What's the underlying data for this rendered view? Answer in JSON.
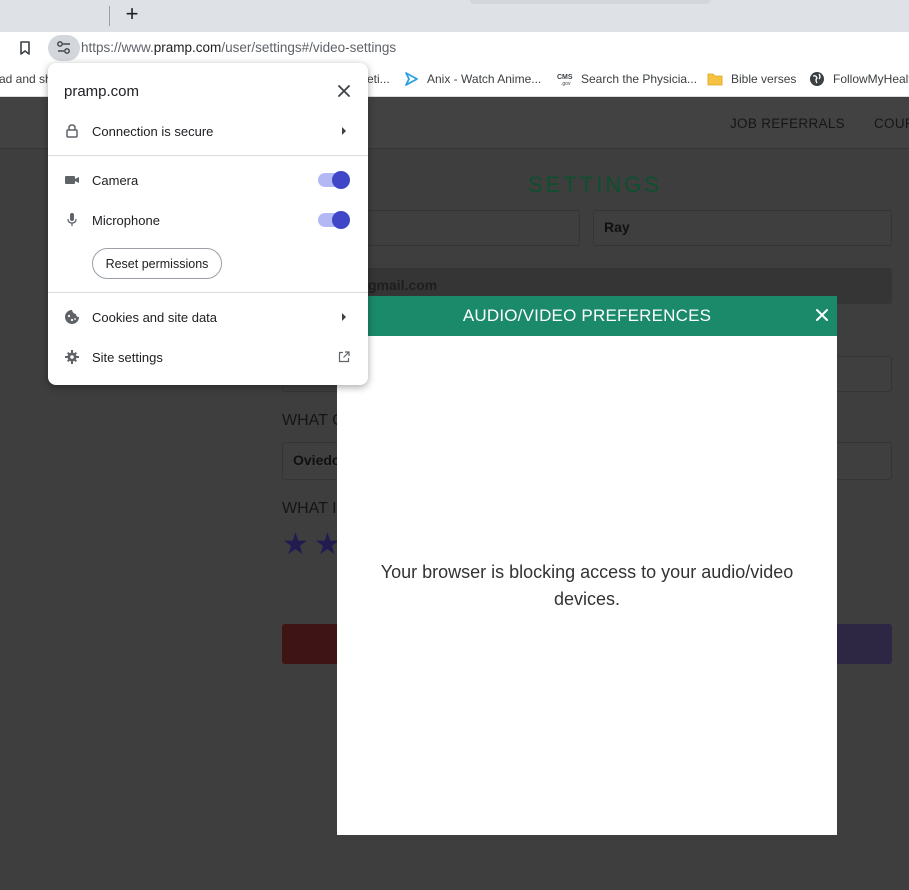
{
  "browser": {
    "new_tab_icon": "+",
    "url_prefix": "https://www.",
    "url_host": "pramp.com",
    "url_path": "/user/settings#/video-settings",
    "bookmarks": [
      {
        "label": "ad and sh",
        "icon": "none"
      },
      {
        "label": "eti...",
        "icon": "none"
      },
      {
        "label": "Anix - Watch Anime...",
        "icon": "play-icon"
      },
      {
        "label": "Search the Physicia...",
        "icon": "cms-icon"
      },
      {
        "label": "Bible verses",
        "icon": "folder-icon"
      },
      {
        "label": "FollowMyHealth",
        "icon": "globe-icon"
      }
    ]
  },
  "page": {
    "nav": [
      {
        "label": "JOB REFERRALS"
      },
      {
        "label": "COURSES"
      }
    ],
    "title": "SETTINGS",
    "last_name_value": "Ray",
    "email_value": "gmail.com",
    "location_label": "WHAT C",
    "location_value": "Oviedo",
    "level_label": "WHAT IS"
  },
  "modal": {
    "title": "AUDIO/VIDEO PREFERENCES",
    "message": "Your browser is blocking access to your audio/video devices."
  },
  "site_info": {
    "domain": "pramp.com",
    "connection_label": "Connection is secure",
    "camera_label": "Camera",
    "camera_enabled": true,
    "microphone_label": "Microphone",
    "microphone_enabled": true,
    "reset_label": "Reset permissions",
    "cookies_label": "Cookies and site data",
    "site_settings_label": "Site settings"
  },
  "colors": {
    "modal_header": "#1a8a6b",
    "toggle_knob": "#4046c8",
    "toggle_track": "#b3b8f5",
    "page_overlay": "#3e3e3e"
  }
}
